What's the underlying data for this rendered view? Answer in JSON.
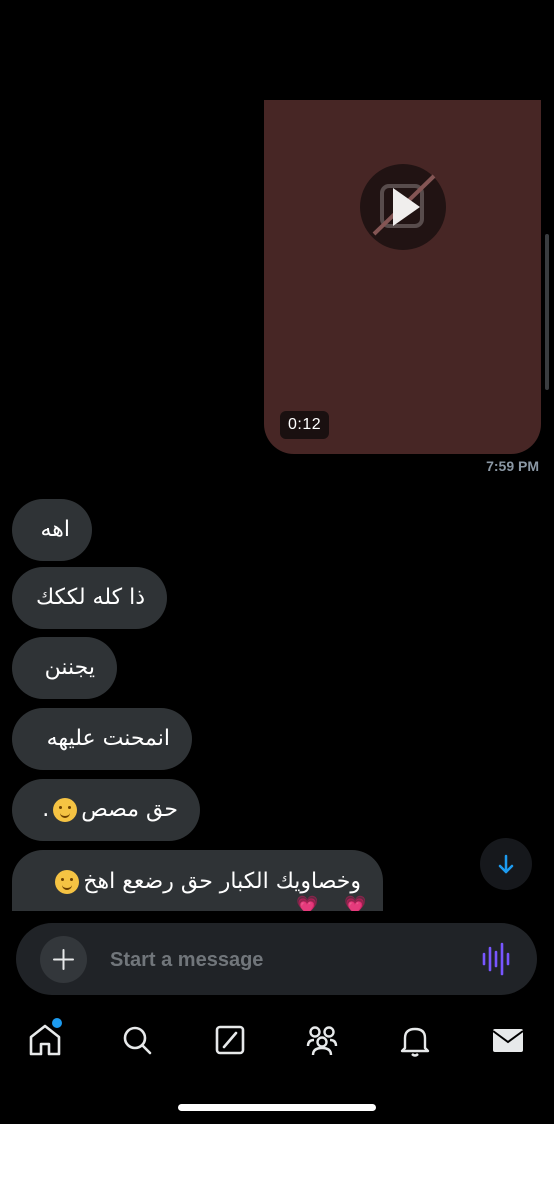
{
  "thread": {
    "video": {
      "duration": "0:12",
      "play_icon": "play-icon"
    },
    "sent_time": "7:59 PM",
    "messages": [
      {
        "text": "اهه"
      },
      {
        "text": "ذا كله لككك"
      },
      {
        "text": "يجننن"
      },
      {
        "text": "انمحنت عليهه"
      },
      {
        "text": "حق مصص",
        "suffix": "."
      },
      {
        "text": "وخصاويك الكبار حق رضعع اهخ",
        "trailing": "💗 💗"
      }
    ]
  },
  "composer": {
    "placeholder": "Start a message"
  },
  "nav": {
    "items": [
      "home-icon",
      "search-icon",
      "grok-icon",
      "communities-icon",
      "notifications-icon",
      "messages-icon"
    ]
  },
  "colors": {
    "accent": "#1d9bf0",
    "bubble": "#2f3336",
    "video_bg": "#472625",
    "voice": "#7856ff"
  }
}
